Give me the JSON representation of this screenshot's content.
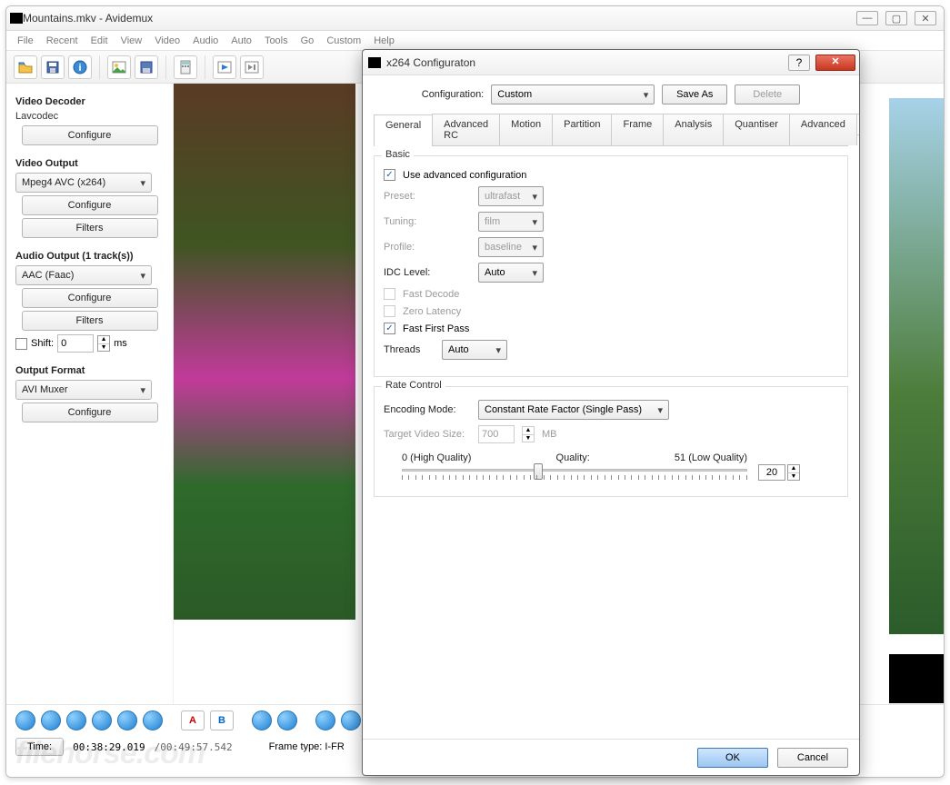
{
  "mainWindow": {
    "title": "Mountains.mkv - Avidemux",
    "menus": [
      "File",
      "Recent",
      "Edit",
      "View",
      "Video",
      "Audio",
      "Auto",
      "Tools",
      "Go",
      "Custom",
      "Help"
    ]
  },
  "leftPanel": {
    "videoDecoder": {
      "label": "Video Decoder",
      "codec": "Lavcodec",
      "configure": "Configure"
    },
    "videoOutput": {
      "label": "Video Output",
      "value": "Mpeg4 AVC (x264)",
      "configure": "Configure",
      "filters": "Filters"
    },
    "audioOutput": {
      "label": "Audio Output (1 track(s))",
      "value": "AAC (Faac)",
      "configure": "Configure",
      "filters": "Filters",
      "shiftLabel": "Shift:",
      "shiftValue": "0",
      "shiftUnit": "ms"
    },
    "outputFormat": {
      "label": "Output Format",
      "value": "AVI Muxer",
      "configure": "Configure"
    }
  },
  "bottom": {
    "timeBtn": "Time:",
    "timeValue": "00:38:29.019",
    "totalTime": "/00:49:57.542",
    "frameType": "Frame type: I-FR"
  },
  "watermark": "filehorse.com",
  "dialog": {
    "title": "x264 Configuraton",
    "configLabel": "Configuration:",
    "configValue": "Custom",
    "saveAs": "Save As",
    "delete": "Delete",
    "tabs": [
      "General",
      "Advanced RC",
      "Motion",
      "Partition",
      "Frame",
      "Analysis",
      "Quantiser",
      "Advanced"
    ],
    "activeTab": "General",
    "basic": {
      "title": "Basic",
      "useAdvanced": "Use advanced configuration",
      "useAdvancedChecked": true,
      "presetLabel": "Preset:",
      "presetValue": "ultrafast",
      "tuningLabel": "Tuning:",
      "tuningValue": "film",
      "profileLabel": "Profile:",
      "profileValue": "baseline",
      "idcLabel": "IDC Level:",
      "idcValue": "Auto",
      "fastDecode": "Fast Decode",
      "fastDecodeChecked": false,
      "zeroLatency": "Zero Latency",
      "zeroLatencyChecked": false,
      "fastFirstPass": "Fast First Pass",
      "fastFirstPassChecked": true,
      "threadsLabel": "Threads",
      "threadsValue": "Auto"
    },
    "rate": {
      "title": "Rate Control",
      "encModeLabel": "Encoding Mode:",
      "encModeValue": "Constant Rate Factor (Single Pass)",
      "targetLabel": "Target Video Size:",
      "targetValue": "700",
      "targetUnit": "MB",
      "sliderLeft": "0 (High Quality)",
      "sliderMid": "Quality:",
      "sliderRight": "51 (Low Quality)",
      "qualityValue": "20",
      "sliderMax": 51
    },
    "ok": "OK",
    "cancel": "Cancel"
  }
}
